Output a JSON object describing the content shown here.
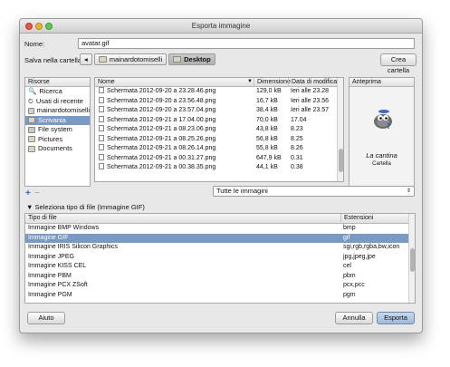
{
  "window": {
    "title": "Esporta immagine"
  },
  "name": {
    "label": "Nome:",
    "value": "avatar.gif"
  },
  "save_in": {
    "label": "Salva nella cartella:",
    "crumbs": [
      "mainardotomiselli",
      "Desktop"
    ],
    "create_folder_label": "Crea cartella"
  },
  "places": {
    "header": "Risorse",
    "items": [
      {
        "label": "Ricerca",
        "icon": "search-icon"
      },
      {
        "label": "Usati di recente",
        "icon": "recent-icon"
      },
      {
        "label": "mainardotomiselli",
        "icon": "home-folder-icon"
      },
      {
        "label": "Scrivania",
        "icon": "desktop-folder-icon"
      },
      {
        "label": "File system",
        "icon": "disk-icon"
      },
      {
        "label": "Pictures",
        "icon": "folder-icon"
      },
      {
        "label": "Documents",
        "icon": "folder-icon"
      }
    ],
    "add_label": "+",
    "remove_label": "−"
  },
  "files": {
    "columns": [
      "Nome",
      "Dimensione",
      "Data di modifica"
    ],
    "rows": [
      {
        "name": "Schermata 2012-09-20 a 23.28.46.png",
        "size": "129,0 kB",
        "date": "Ieri alle 23.28"
      },
      {
        "name": "Schermata 2012-09-20 a 23.56.48.png",
        "size": "16,7 kB",
        "date": "Ieri alle 23.56"
      },
      {
        "name": "Schermata 2012-09-20 a 23.57.04.png",
        "size": "38,4 kB",
        "date": "Ieri alle 23.57"
      },
      {
        "name": "Schermata 2012-09-21 a 17.04.00.png",
        "size": "70,0 kB",
        "date": "17.04"
      },
      {
        "name": "Schermata 2012-09-21 a 08.23.06.png",
        "size": "43,8 kB",
        "date": "8.23"
      },
      {
        "name": "Schermata 2012-09-21 a 08.25.26.png",
        "size": "56,8 kB",
        "date": "8.25"
      },
      {
        "name": "Schermata 2012-09-21 a 08.26.14.png",
        "size": "55,8 kB",
        "date": "8.26"
      },
      {
        "name": "Schermata 2012-09-21 a 00.31.27.png",
        "size": "647,9 kB",
        "date": "0.31"
      },
      {
        "name": "Schermata 2012-09-21 a 00.38.35.png",
        "size": "44,1 kB",
        "date": "0.38"
      }
    ]
  },
  "preview": {
    "header": "Anteprima",
    "title": "La cantina",
    "subtitle": "Cartella"
  },
  "filter": {
    "value": "Tutte le immagini"
  },
  "filetype": {
    "toggle_label": "Seleziona tipo di file (Immagine GIF)",
    "columns": [
      "Tipo di file",
      "Estensioni"
    ],
    "selected_index": 1,
    "rows": [
      {
        "type": "Immagine BMP Windows",
        "ext": "bmp"
      },
      {
        "type": "Immagine GIF",
        "ext": "gif"
      },
      {
        "type": "Immagine IRIS Silicon Graphics",
        "ext": "sgi,rgb,rgba,bw,icon"
      },
      {
        "type": "Immagine JPEG",
        "ext": "jpg,jpeg,jpe"
      },
      {
        "type": "Immagine KISS CEL",
        "ext": "cel"
      },
      {
        "type": "Immagine PBM",
        "ext": "pbm"
      },
      {
        "type": "Immagine PCX ZSoft",
        "ext": "pcx,pcc"
      },
      {
        "type": "Immagine PGM",
        "ext": "pgm"
      }
    ]
  },
  "footer": {
    "help_label": "Aiuto",
    "cancel_label": "Annulla",
    "export_label": "Esporta"
  },
  "colors": {
    "selection": "#7a9ac3",
    "primary_button": "#9fb8d8"
  }
}
